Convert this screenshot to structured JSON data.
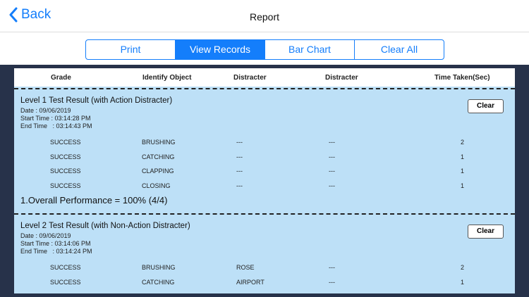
{
  "nav": {
    "back_label": "Back",
    "title": "Report"
  },
  "segments": [
    {
      "label": "Print"
    },
    {
      "label": "View Records",
      "active": true
    },
    {
      "label": "Bar Chart"
    },
    {
      "label": "Clear All"
    }
  ],
  "columns": [
    "Grade",
    "Identify Object",
    "Distracter",
    "Distracter",
    "Time Taken(Sec)"
  ],
  "sections": [
    {
      "title": "Level 1 Test Result (with Action Distracter)",
      "date": "Date : 09/06/2019",
      "start": "Start Time : 03:14:28 PM",
      "end": "End Time   : 03:14:43 PM",
      "clear_label": "Clear",
      "rows": [
        [
          "SUCCESS",
          "BRUSHING",
          "---",
          "---",
          "2"
        ],
        [
          "SUCCESS",
          "CATCHING",
          "---",
          "---",
          "1"
        ],
        [
          "SUCCESS",
          "CLAPPING",
          "---",
          "---",
          "1"
        ],
        [
          "SUCCESS",
          "CLOSING",
          "---",
          "---",
          "1"
        ]
      ],
      "performance": "1.Overall Performance = 100% (4/4)"
    },
    {
      "title": "Level 2 Test Result (with Non-Action Distracter)",
      "date": "Date : 09/06/2019",
      "start": "Start Time : 03:14:06 PM",
      "end": "End Time   : 03:14:24 PM",
      "clear_label": "Clear",
      "rows": [
        [
          "SUCCESS",
          "BRUSHING",
          "ROSE",
          "---",
          "2"
        ],
        [
          "SUCCESS",
          "CATCHING",
          "AIRPORT",
          "---",
          "1"
        ]
      ]
    }
  ]
}
